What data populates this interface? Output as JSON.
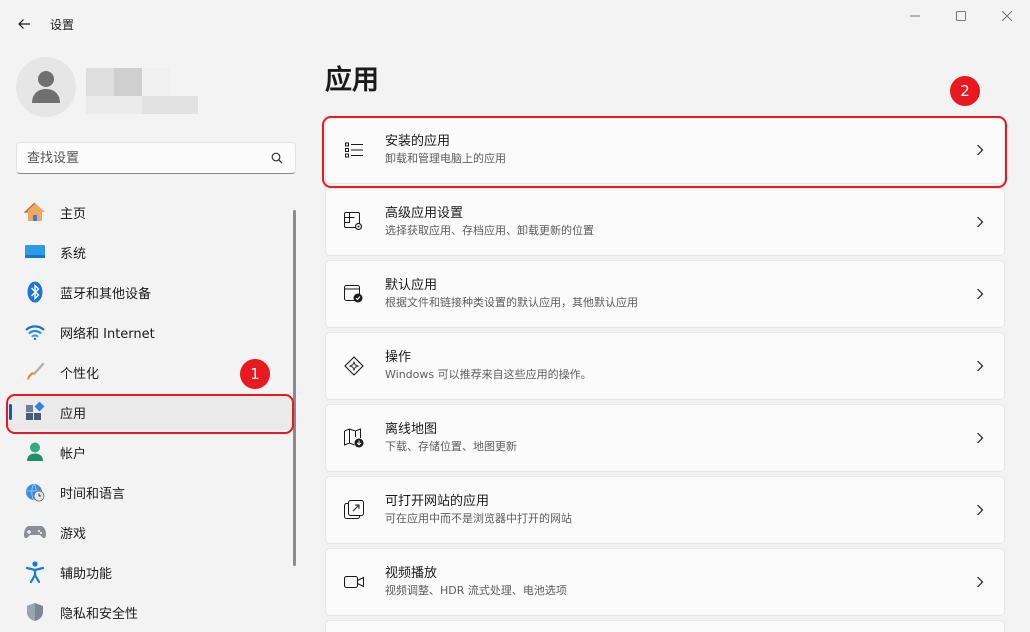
{
  "window": {
    "title": "设置",
    "controls": [
      "minimize",
      "maximize",
      "close"
    ]
  },
  "search": {
    "placeholder": "查找设置"
  },
  "sidebar": {
    "items": [
      {
        "label": "主页",
        "icon": "home-icon",
        "active": false
      },
      {
        "label": "系统",
        "icon": "monitor-icon",
        "active": false
      },
      {
        "label": "蓝牙和其他设备",
        "icon": "bluetooth-icon",
        "active": false
      },
      {
        "label": "网络和 Internet",
        "icon": "wifi-icon",
        "active": false
      },
      {
        "label": "个性化",
        "icon": "brush-icon",
        "active": false
      },
      {
        "label": "应用",
        "icon": "apps-icon",
        "active": true
      },
      {
        "label": "帐户",
        "icon": "person-icon",
        "active": false
      },
      {
        "label": "时间和语言",
        "icon": "clock-globe-icon",
        "active": false
      },
      {
        "label": "游戏",
        "icon": "gamepad-icon",
        "active": false
      },
      {
        "label": "辅助功能",
        "icon": "accessibility-icon",
        "active": false
      },
      {
        "label": "隐私和安全性",
        "icon": "shield-icon",
        "active": false
      }
    ]
  },
  "main": {
    "title": "应用",
    "cards": [
      {
        "title": "安装的应用",
        "subtitle": "卸载和管理电脑上的应用",
        "icon": "list-icon"
      },
      {
        "title": "高级应用设置",
        "subtitle": "选择获取应用、存档应用、卸载更新的位置",
        "icon": "app-settings-icon"
      },
      {
        "title": "默认应用",
        "subtitle": "根据文件和链接种类设置的默认应用，其他默认应用",
        "icon": "default-app-icon"
      },
      {
        "title": "操作",
        "subtitle": "Windows 可以推荐来自这些应用的操作。",
        "icon": "sparkle-icon"
      },
      {
        "title": "离线地图",
        "subtitle": "下载、存储位置、地图更新",
        "icon": "offline-map-icon"
      },
      {
        "title": "可打开网站的应用",
        "subtitle": "可在应用中而不是浏览器中打开的网站",
        "icon": "open-link-icon"
      },
      {
        "title": "视频播放",
        "subtitle": "视频调整、HDR 流式处理、电池选项",
        "icon": "video-icon"
      }
    ]
  },
  "annotations": {
    "badge_1": "1",
    "badge_2": "2",
    "color": "#e8191f"
  },
  "colors": {
    "accent": "#005fb8",
    "background": "#f3f3f3",
    "card": "#fbfbfb"
  }
}
